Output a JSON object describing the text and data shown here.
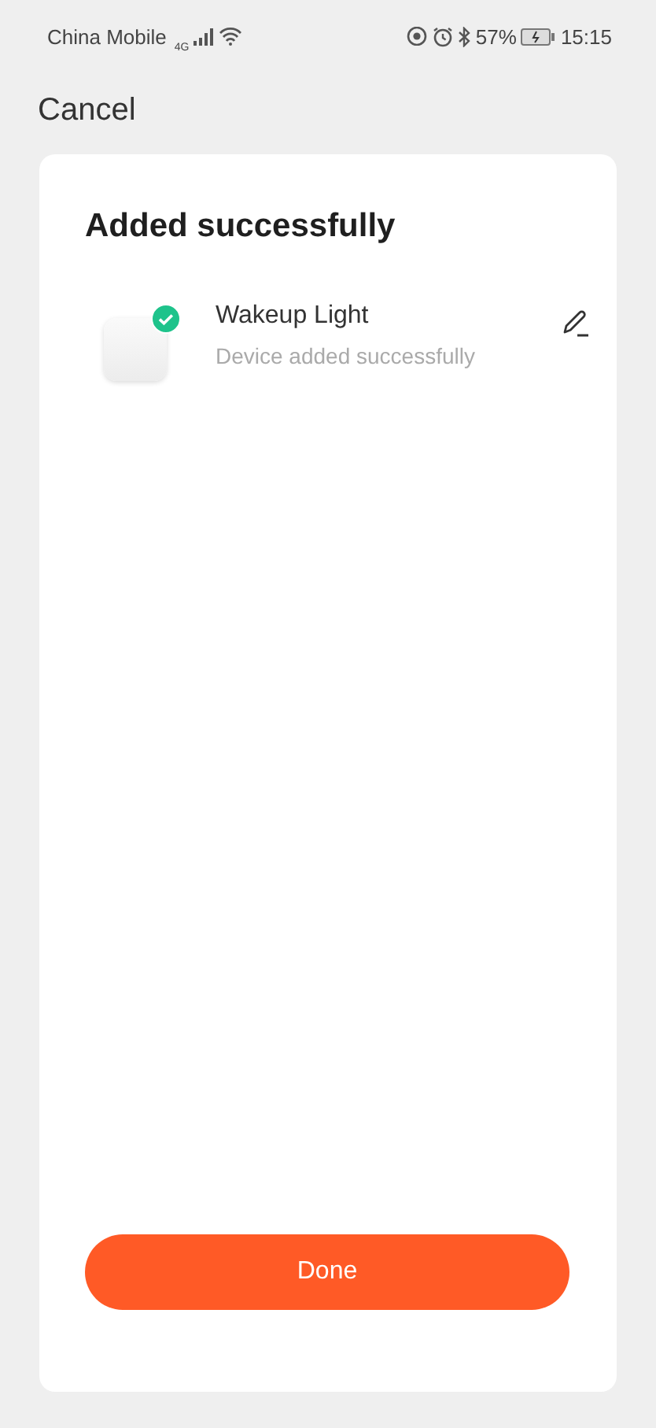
{
  "status_bar": {
    "carrier": "China Mobile",
    "network": "4G",
    "battery": "57%",
    "time": "15:15"
  },
  "nav": {
    "cancel": "Cancel"
  },
  "card": {
    "title": "Added successfully",
    "devices": [
      {
        "name": "Wakeup Light",
        "status": "Device added successfully",
        "added": true
      }
    ],
    "done": "Done"
  }
}
